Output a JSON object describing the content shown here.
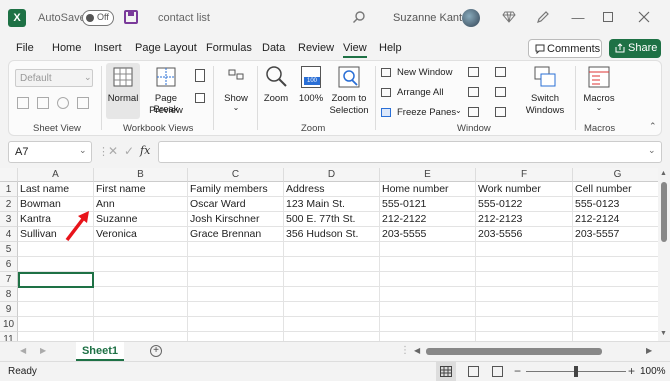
{
  "titlebar": {
    "app_badge": "X",
    "autosave_label": "AutoSave",
    "autosave_state": "Off",
    "filename": "contact list",
    "username": "Suzanne Kantra"
  },
  "menu": {
    "items": [
      "File",
      "Home",
      "Insert",
      "Page Layout",
      "Formulas",
      "Data",
      "Review",
      "View",
      "Help"
    ],
    "active": "View",
    "comments_label": "Comments",
    "share_label": "Share"
  },
  "ribbon": {
    "sheet_view": {
      "label": "Sheet View",
      "dropdown_value": "Default"
    },
    "workbook_views": {
      "label": "Workbook Views",
      "normal": "Normal",
      "page_break_1": "Page Break",
      "page_break_2": "Preview"
    },
    "show": {
      "label": "Show"
    },
    "zoom": {
      "label": "Zoom",
      "zoom_btn": "Zoom",
      "hundred": "100%",
      "zoom_sel_1": "Zoom to",
      "zoom_sel_2": "Selection",
      "hundred_badge": "100"
    },
    "window": {
      "label": "Window",
      "new_window": "New Window",
      "arrange_all": "Arrange All",
      "freeze_panes": "Freeze Panes",
      "switch_1": "Switch",
      "switch_2": "Windows"
    },
    "macros": {
      "label": "Macros",
      "macros_btn": "Macros"
    }
  },
  "formula_bar": {
    "name_box": "A7",
    "fx": "fx",
    "content": ""
  },
  "grid": {
    "columns": [
      "A",
      "B",
      "C",
      "D",
      "E",
      "F",
      "G"
    ],
    "rows": [
      "1",
      "2",
      "3",
      "4",
      "5",
      "6",
      "7",
      "8",
      "9",
      "10",
      "11"
    ],
    "cells": [
      [
        "Last name",
        "First name",
        "Family members",
        "Address",
        "Home number",
        "Work number",
        "Cell number"
      ],
      [
        "Bowman",
        "Ann",
        "Oscar Ward",
        "123 Main St.",
        "555-0121",
        "555-0122",
        "555-0123"
      ],
      [
        "Kantra",
        "Suzanne",
        "Josh Kirschner",
        "500 E. 77th St.",
        "212-2122",
        "212-2123",
        "212-2124"
      ],
      [
        "Sullivan",
        "Veronica",
        "Grace Brennan",
        "356 Hudson St.",
        "203-5555",
        "203-5556",
        "203-5557"
      ]
    ]
  },
  "sheet_tabs": {
    "active": "Sheet1",
    "add": "+"
  },
  "status": {
    "ready": "Ready",
    "zoom": "100%",
    "zoom_minus": "−",
    "zoom_plus": "+"
  },
  "colors": {
    "accent": "#1e7145",
    "annotation_arrow": "#e8141b"
  }
}
